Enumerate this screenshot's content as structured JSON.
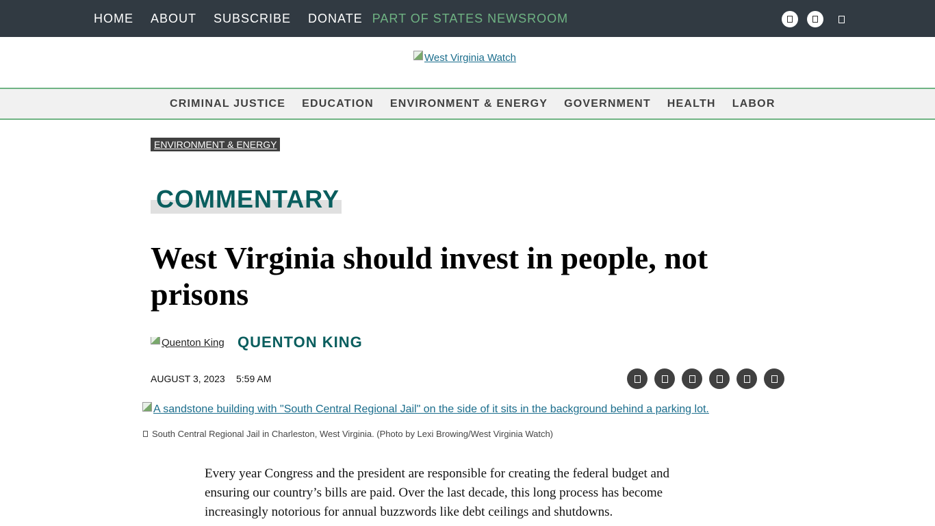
{
  "topnav": {
    "links": [
      "HOME",
      "ABOUT",
      "SUBSCRIBE",
      "DONATE"
    ],
    "states_link": "PART OF STATES NEWSROOM"
  },
  "social_icons": [
    "facebook-icon",
    "twitter-icon",
    "instagram-icon"
  ],
  "logo": {
    "alt": "West Virginia Watch"
  },
  "catnav": [
    "CRIMINAL JUSTICE",
    "EDUCATION",
    "ENVIRONMENT & ENERGY",
    "GOVERNMENT",
    "HEALTH",
    "LABOR"
  ],
  "article": {
    "tag": "ENVIRONMENT & ENERGY",
    "section": "COMMENTARY",
    "headline": "West Virginia should invest in people, not prisons",
    "author_avatar_alt": "Quenton King",
    "author_name": "QUENTON KING",
    "date": "AUGUST 3, 2023",
    "time": "5:59 AM",
    "share_icons": [
      "facebook-icon",
      "twitter-icon",
      "email-icon",
      "print-icon",
      "reddit-icon",
      "linkedin-icon"
    ],
    "hero_alt": "A sandstone building with \"South Central Regional Jail\" on the side of it sits in the background behind a parking lot.",
    "caption": "South Central Regional Jail in Charleston, West Virginia. (Photo by Lexi Browing/West Virginia Watch)",
    "body": "Every year Congress and the president are responsible for creating the federal budget and ensuring our country’s bills are paid. Over the last decade, this long process has become increasingly notorious for annual buzzwords like debt ceilings and shutdowns."
  },
  "colors": {
    "topbar": "#313a42",
    "accent_green": "#6fb383",
    "teal": "#0a5e5e",
    "link": "#1a6d8c",
    "tag_bg": "#404040"
  }
}
